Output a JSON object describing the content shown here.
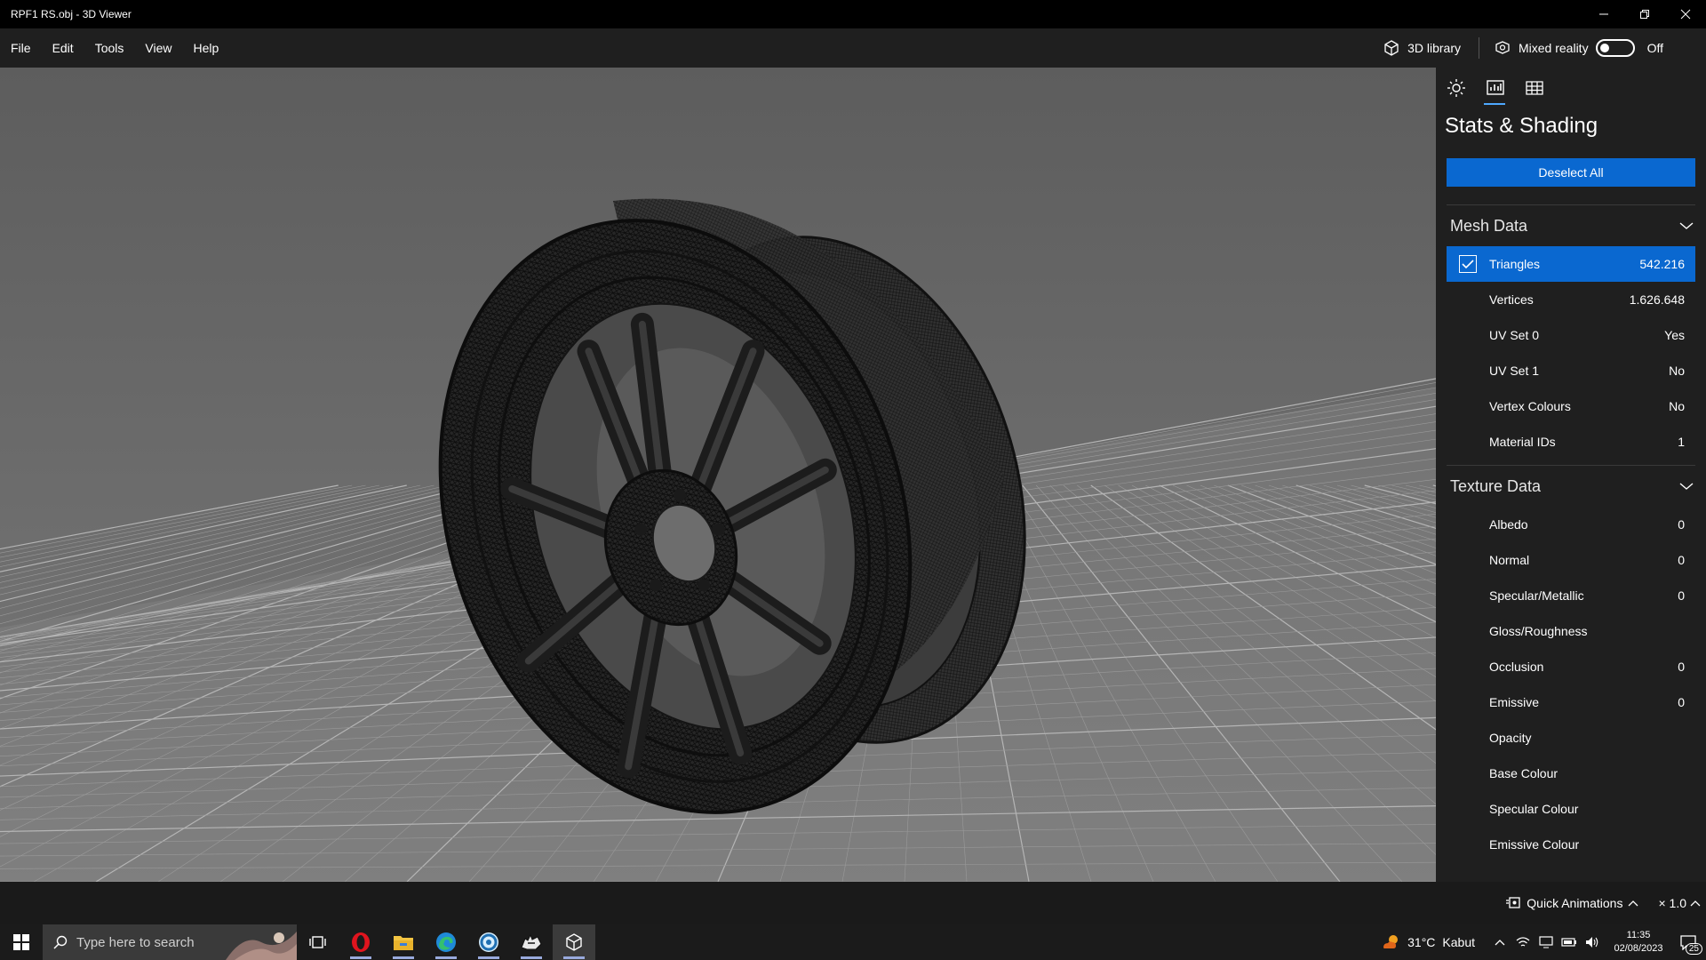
{
  "window": {
    "title": "RPF1 RS.obj - 3D Viewer",
    "controls": [
      "minimize-icon",
      "restore-icon",
      "close-icon"
    ]
  },
  "menu": {
    "items": [
      "File",
      "Edit",
      "Tools",
      "View",
      "Help"
    ],
    "library_label": "3D library",
    "mixed_reality_label": "Mixed reality",
    "mixed_reality_state": "Off"
  },
  "panel": {
    "tabs": [
      "sun-icon",
      "stats-icon",
      "grid-icon"
    ],
    "active_tab": "stats-icon",
    "title": "Stats & Shading",
    "deselect_label": "Deselect All",
    "mesh_section": "Mesh Data",
    "mesh_rows": [
      {
        "label": "Triangles",
        "value": "542.216",
        "checked": true
      },
      {
        "label": "Vertices",
        "value": "1.626.648"
      },
      {
        "label": "UV Set 0",
        "value": "Yes"
      },
      {
        "label": "UV Set 1",
        "value": "No"
      },
      {
        "label": "Vertex Colours",
        "value": "No"
      },
      {
        "label": "Material IDs",
        "value": "1"
      }
    ],
    "texture_section": "Texture Data",
    "texture_rows": [
      {
        "label": "Albedo",
        "value": "0"
      },
      {
        "label": "Normal",
        "value": "0"
      },
      {
        "label": "Specular/Metallic",
        "value": "0"
      },
      {
        "label": "Gloss/Roughness",
        "value": ""
      },
      {
        "label": "Occlusion",
        "value": "0"
      },
      {
        "label": "Emissive",
        "value": "0"
      },
      {
        "label": "Opacity",
        "value": ""
      },
      {
        "label": "Base Colour",
        "value": ""
      },
      {
        "label": "Specular Colour",
        "value": ""
      },
      {
        "label": "Emissive Colour",
        "value": ""
      }
    ]
  },
  "statusbar": {
    "quick_animations": "Quick Animations",
    "speed": "× 1.0"
  },
  "taskbar": {
    "search_placeholder": "Type here to search",
    "apps": [
      "task-view-icon",
      "opera-icon",
      "file-explorer-icon",
      "edge-icon",
      "app-circle-icon",
      "rhino-icon",
      "3d-viewer-icon"
    ],
    "weather_temp": "31°C",
    "weather_text": "Kabut",
    "time": "11:35",
    "date": "02/08/2023",
    "notifications": "25"
  },
  "colors": {
    "accent": "#0a68d0",
    "panel_bg": "#1f1f1f",
    "viewport_bg": "#666666"
  }
}
